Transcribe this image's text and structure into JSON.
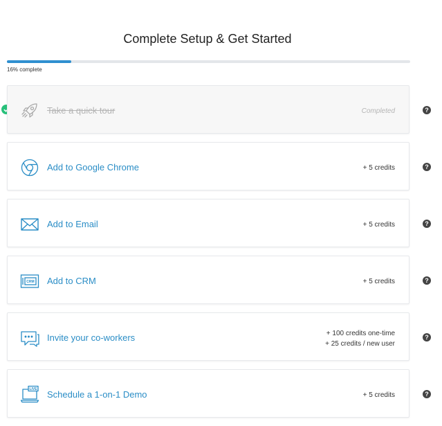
{
  "header": {
    "title": "Complete Setup & Get Started"
  },
  "progress": {
    "percent": 16,
    "label": "16% complete"
  },
  "colors": {
    "accent": "#2a8dc6",
    "progress": "#2f8fd0",
    "success": "#27c07a",
    "muted": "#b5b5b5"
  },
  "steps": [
    {
      "label": "Take a quick tour",
      "icon": "rocket-icon",
      "reward": "Completed",
      "completed": true
    },
    {
      "label": "Add to Google Chrome",
      "icon": "chrome-icon",
      "reward": "+ 5 credits",
      "completed": false
    },
    {
      "label": "Add to Email",
      "icon": "envelope-icon",
      "reward": "+ 5 credits",
      "completed": false
    },
    {
      "label": "Add to CRM",
      "icon": "crm-icon",
      "icon_text": "CRM",
      "reward": "+ 5 credits",
      "completed": false
    },
    {
      "label": "Invite your co-workers",
      "icon": "chat-bubble-icon",
      "reward_lines": [
        "+ 100 credits one-time",
        "+ 25 credits / new user"
      ],
      "completed": false
    },
    {
      "label": "Schedule a 1-on-1 Demo",
      "icon": "live-demo-icon",
      "icon_text": "LIVE",
      "reward": "+ 5 credits",
      "completed": false
    }
  ],
  "help": {
    "glyph": "?"
  },
  "status": {
    "check_glyph": "✓"
  }
}
